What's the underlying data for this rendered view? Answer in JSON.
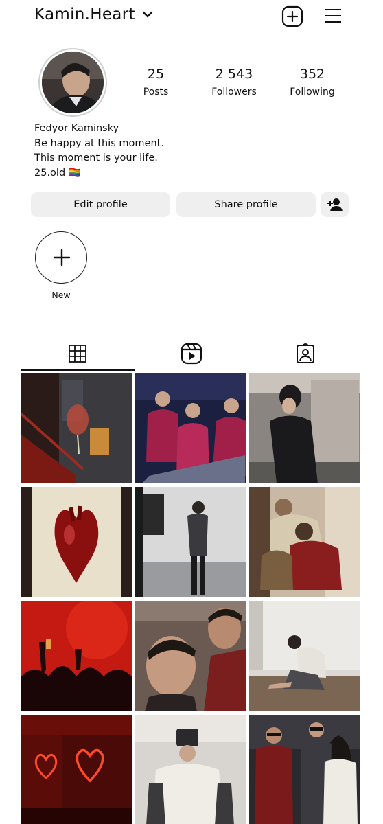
{
  "header": {
    "username": "Kamin.Heart",
    "chevron_icon": "chevron-down-icon",
    "create_icon": "plus-square-icon",
    "menu_icon": "hamburger-menu-icon"
  },
  "profile": {
    "stats": [
      {
        "value": "25",
        "label": "Posts"
      },
      {
        "value": "2 543",
        "label": "Followers"
      },
      {
        "value": "352",
        "label": "Following"
      }
    ],
    "bio": {
      "name": "Fedyor Kaminsky",
      "line1": "Be happy at this moment.",
      "line2": "This moment is your life.",
      "line3": "25.old 🏳️‍🌈"
    }
  },
  "actions": {
    "edit_profile": "Edit profile",
    "share_profile": "Share profile",
    "add_user_icon": "person-add-icon"
  },
  "highlights": {
    "new_label": "New"
  },
  "tabs": [
    {
      "icon": "grid-icon",
      "active": true
    },
    {
      "icon": "reels-icon",
      "active": false
    },
    {
      "icon": "tagged-icon",
      "active": false
    }
  ]
}
